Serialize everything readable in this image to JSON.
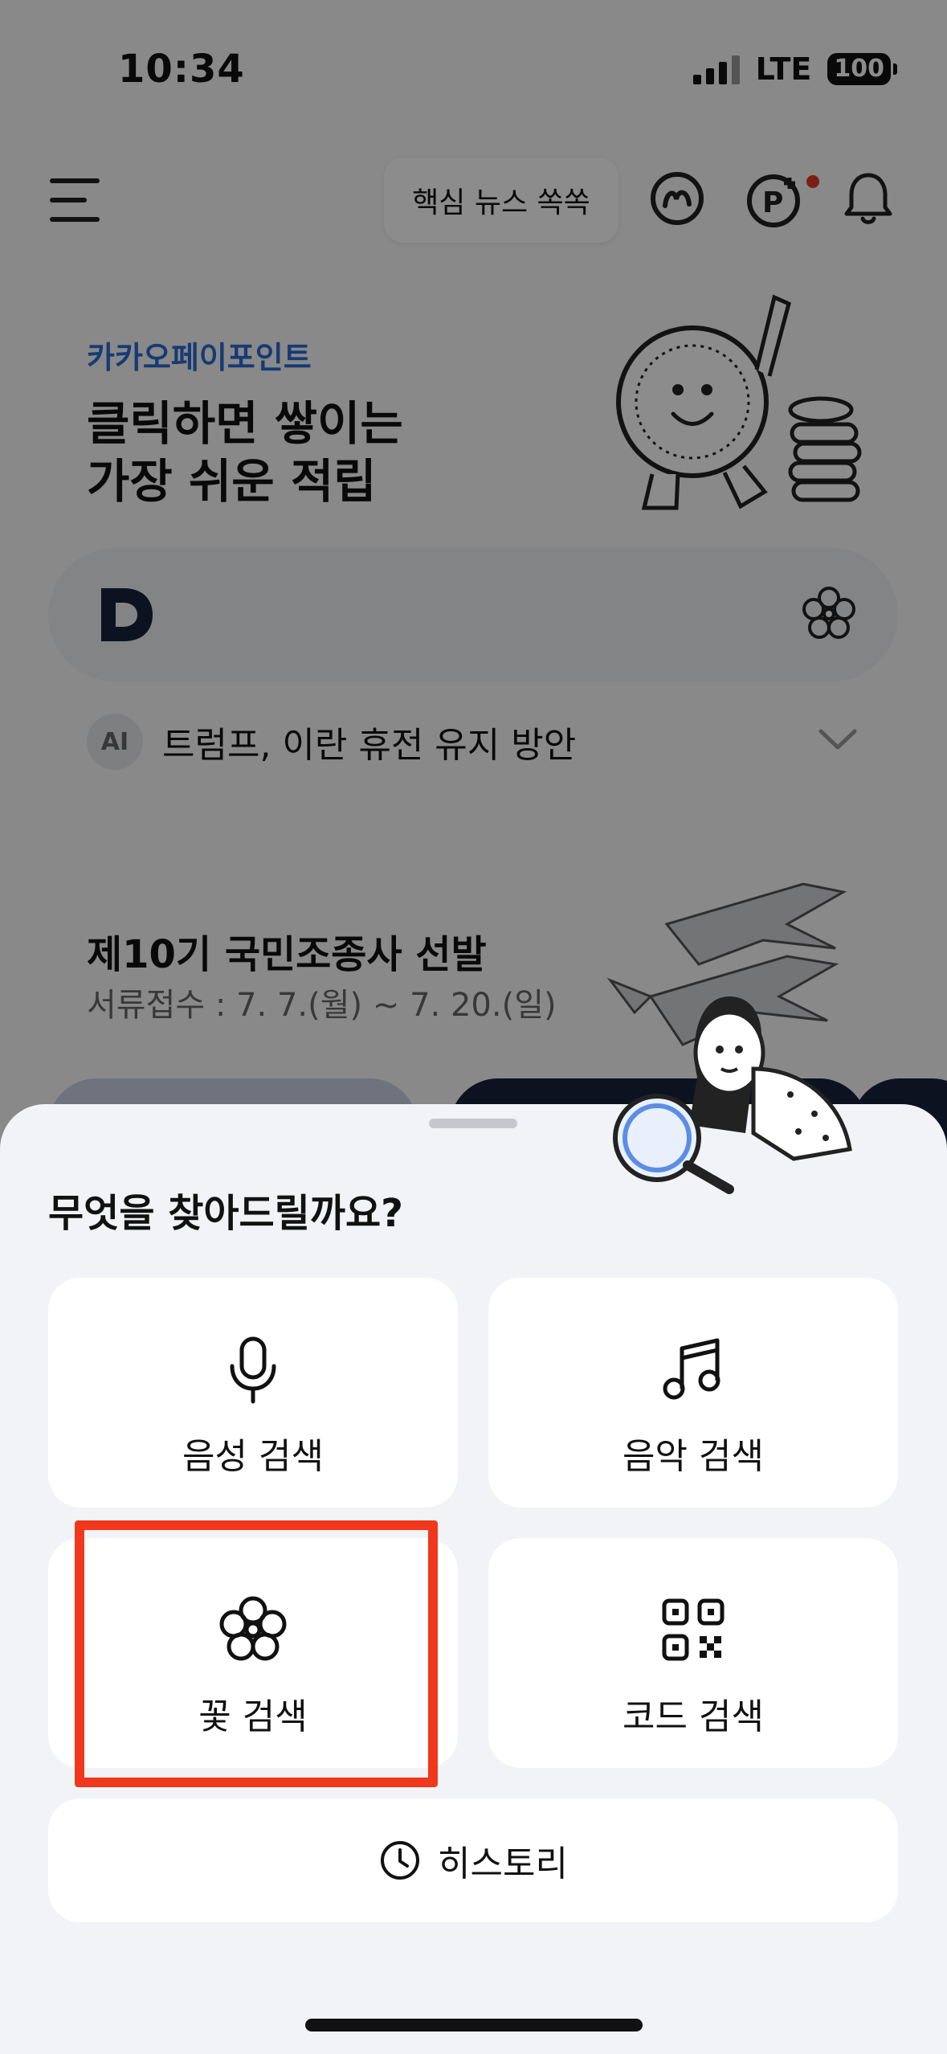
{
  "status_bar": {
    "time": "10:34",
    "network": "LTE",
    "battery": "100"
  },
  "header": {
    "tooltip": "핵심 뉴스 쏙쏙"
  },
  "promo": {
    "brand": "카카오페이포인트",
    "line1": "클릭하면 쌓이는",
    "line2": "가장 쉬운 적립"
  },
  "ai_suggestion": {
    "badge": "AI",
    "text": "트럼프, 이란 휴전 유지 방안"
  },
  "event": {
    "title": "제10기 국민조종사 선발",
    "subtitle": "서류접수 : 7. 7.(월) ~ 7. 20.(일)"
  },
  "sheet": {
    "title": "무엇을 찾아드릴까요?",
    "options": [
      {
        "label": "음성 검색",
        "icon": "microphone-icon"
      },
      {
        "label": "음악 검색",
        "icon": "music-note-icon"
      },
      {
        "label": "꽃 검색",
        "icon": "flower-icon"
      },
      {
        "label": "코드 검색",
        "icon": "qr-code-icon"
      }
    ],
    "history_label": "히스토리",
    "highlighted_option": "꽃 검색"
  },
  "colors": {
    "brand_blue": "#2a6bd6",
    "highlight_red": "#f2381c",
    "notification_dot": "#e3362b",
    "sheet_bg": "#f2f3f6"
  }
}
